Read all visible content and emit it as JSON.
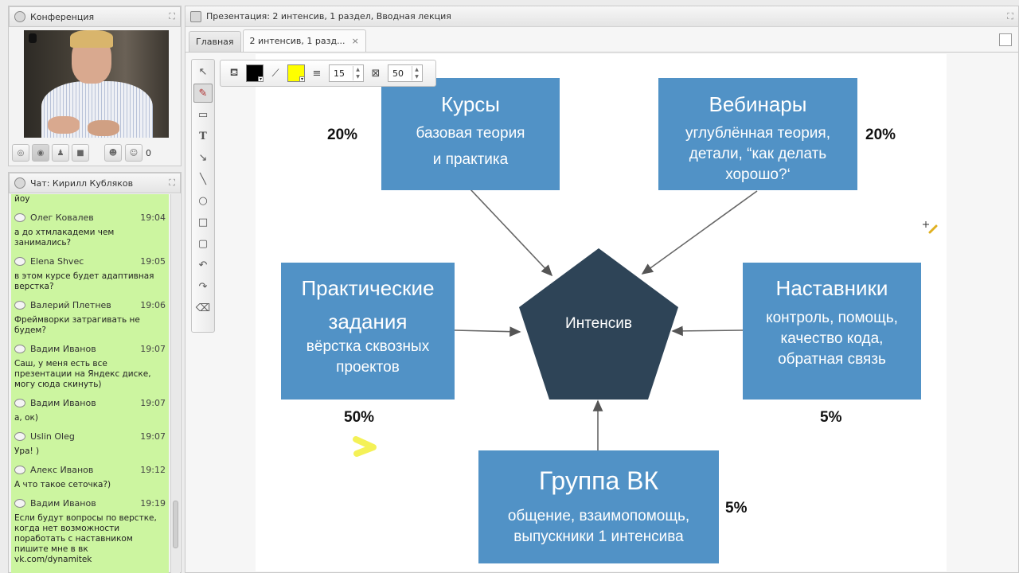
{
  "conference": {
    "title": "Конференция",
    "participant_count": "0"
  },
  "chat": {
    "title": "Чат: Кирилл Кубляков",
    "top_fragment": "йоу",
    "messages": [
      {
        "author": "Олег Ковалев",
        "time": "19:04",
        "text": "а до хтмлакадеми чем занимались?"
      },
      {
        "author": "Elena Shvec",
        "time": "19:05",
        "text": "в этом курсе будет адаптивная верстка?"
      },
      {
        "author": "Валерий Плетнев",
        "time": "19:06",
        "text": "Фреймворки затрагивать не будем?"
      },
      {
        "author": "Вадим Иванов",
        "time": "19:07",
        "text": "Саш, у меня есть все презентации на Яндекс диске, могу сюда скинуть)"
      },
      {
        "author": "Вадим Иванов",
        "time": "19:07",
        "text": "а, ок)"
      },
      {
        "author": "Uslin Oleg",
        "time": "19:07",
        "text": "Ура! )"
      },
      {
        "author": "Алекс Иванов",
        "time": "19:12",
        "text": "А что такое сеточка?)"
      },
      {
        "author": "Вадим Иванов",
        "time": "19:19",
        "text": "Если будут вопросы по верстке, когда нет возможности поработать с наставником пишите мне в вк vk.com/dynamitek"
      }
    ]
  },
  "presentation": {
    "title": "Презентация: 2 интенсив, 1 раздел,  Вводная лекция",
    "tabs": [
      {
        "label": "Главная",
        "active": false
      },
      {
        "label": "2 интенсив, 1 разд...",
        "active": true
      }
    ],
    "close_glyph": "×"
  },
  "toolbar": {
    "stroke_width": "15",
    "opacity": "50",
    "stroke_color": "#000000",
    "fill_color": "#ffff00",
    "tools": [
      "pointer-icon",
      "pen-icon",
      "rectangle-icon",
      "text-icon",
      "arrow-icon",
      "line-icon",
      "ellipse-icon",
      "square-icon",
      "rounded-rect-icon",
      "undo-icon",
      "redo-icon",
      "eraser-icon"
    ]
  },
  "slide": {
    "center": "Интенсив",
    "courses": {
      "title": "Курсы",
      "sub1": "базовая теория",
      "sub2": "и практика",
      "pct": "20%"
    },
    "webinars": {
      "title": "Вебинары",
      "sub1": "углублённая теория,",
      "sub2": "детали, “как делать",
      "sub3": "хорошо?‘",
      "pct": "20%"
    },
    "practice": {
      "title1": "Практические",
      "title2": "задания",
      "sub1": "вёрстка сквозных",
      "sub2": "проектов",
      "pct": "50%"
    },
    "mentors": {
      "title": "Наставники",
      "sub1": "контроль, помощь,",
      "sub2": "качество кода,",
      "sub3": "обратная связь",
      "pct": "5%"
    },
    "vk": {
      "title": "Группа ВК",
      "sub1": "общение, взаимопомощь,",
      "sub2": "выпускники 1 интенсива",
      "pct": "5%"
    },
    "colors": {
      "box": "#5192c6",
      "pentagon": "#2e4457",
      "highlight": "#f2ef3a"
    }
  }
}
